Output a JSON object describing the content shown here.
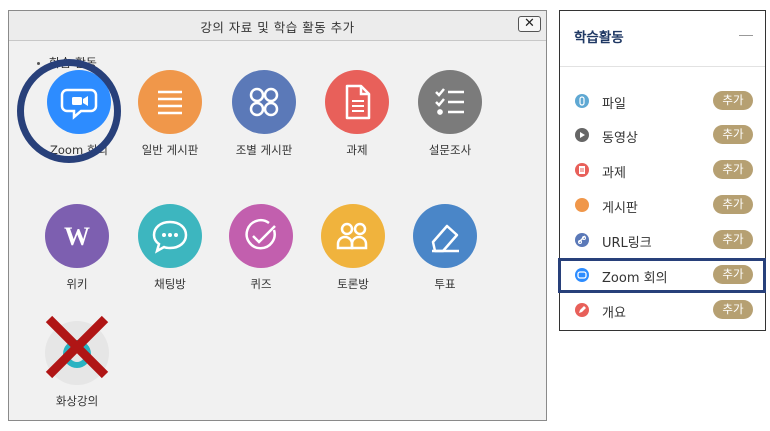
{
  "dialog": {
    "title": "강의 자료 및 학습 활동 추가",
    "close_label": "✕",
    "section_label": "학습 활동",
    "tiles": [
      {
        "label": "Zoom 회의",
        "color": "#2d8cff",
        "icon": "zoom-icon"
      },
      {
        "label": "일반 게시판",
        "color": "#f0974a",
        "icon": "list-icon"
      },
      {
        "label": "조별 게시판",
        "color": "#5b79b8",
        "icon": "group-grid-icon"
      },
      {
        "label": "과제",
        "color": "#e8605a",
        "icon": "document-icon"
      },
      {
        "label": "설문조사",
        "color": "#7b7b7b",
        "icon": "checklist-icon"
      },
      {
        "label": "위키",
        "color": "#7d5fb0",
        "icon": "wiki-icon"
      },
      {
        "label": "채팅방",
        "color": "#3db6bf",
        "icon": "chat-icon"
      },
      {
        "label": "퀴즈",
        "color": "#c25fae",
        "icon": "check-circle-icon"
      },
      {
        "label": "토론방",
        "color": "#f0b33d",
        "icon": "people-icon"
      },
      {
        "label": "투표",
        "color": "#4a86c8",
        "icon": "eraser-icon"
      },
      {
        "label": "화상강의",
        "color": "#e6e6e6",
        "icon": "video-lecture-icon"
      }
    ]
  },
  "panel": {
    "title": "학습활동",
    "collapse_icon": "minus-icon",
    "add_label": "추가",
    "items": [
      {
        "label": "파일",
        "color": "#5fa8d3",
        "icon": "file-icon"
      },
      {
        "label": "동영상",
        "color": "#666666",
        "icon": "play-icon"
      },
      {
        "label": "과제",
        "color": "#e8605a",
        "icon": "assignment-icon"
      },
      {
        "label": "게시판",
        "color": "#f0974a",
        "icon": "board-icon"
      },
      {
        "label": "URL링크",
        "color": "#5b79b8",
        "icon": "link-icon"
      },
      {
        "label": "Zoom 회의",
        "color": "#2d8cff",
        "icon": "zoom-icon"
      },
      {
        "label": "개요",
        "color": "#e8605a",
        "icon": "pencil-icon"
      }
    ]
  }
}
